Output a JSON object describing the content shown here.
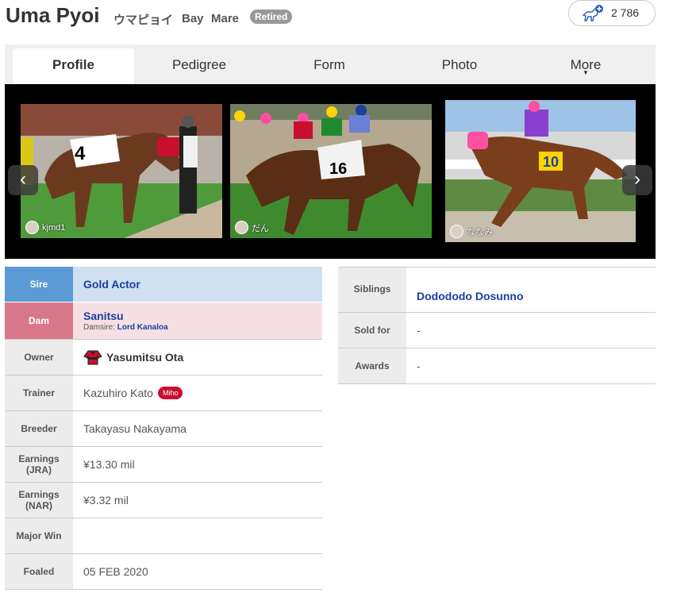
{
  "header": {
    "name": "Uma Pyoi",
    "kana": "ウマピョイ",
    "coat": "Bay",
    "sex": "Mare",
    "status_badge": "Retired",
    "favorites_count": "2 786"
  },
  "tabs": [
    "Profile",
    "Pedigree",
    "Form",
    "Photo",
    "More"
  ],
  "active_tab": "Profile",
  "photos": [
    {
      "user": "kjmd1"
    },
    {
      "user": "だん"
    },
    {
      "user": "ななみ"
    }
  ],
  "profile_left": {
    "sire_label": "Sire",
    "sire": "Gold Actor",
    "dam_label": "Dam",
    "dam": "Sanitsu",
    "damsire_label": "Damsire:",
    "damsire": "Lord Kanaloa",
    "owner_label": "Owner",
    "owner": "Yasumitsu Ota",
    "trainer_label": "Trainer",
    "trainer": "Kazuhiro Kato",
    "trainer_badge": "Miho",
    "breeder_label": "Breeder",
    "breeder": "Takayasu Nakayama",
    "earnings_jra_label": "Earnings (JRA)",
    "earnings_jra": "¥13.30 mil",
    "earnings_nar_label": "Earnings (NAR)",
    "earnings_nar": "¥3.32 mil",
    "major_win_label": "Major Win",
    "major_win": "",
    "foaled_label": "Foaled",
    "foaled": "05 FEB 2020"
  },
  "profile_right": {
    "siblings_label": "Siblings",
    "siblings": "Dodododo Dosunno",
    "sold_for_label": "Sold for",
    "sold_for": "-",
    "awards_label": "Awards",
    "awards": "-"
  },
  "colors": {
    "sire_header": "#5b9bd5",
    "sire_cell": "#cfe0f1",
    "dam_header": "#d9778a",
    "dam_cell": "#f6e0e4",
    "link": "#1a3fa0",
    "miho_badge": "#c8102e"
  }
}
